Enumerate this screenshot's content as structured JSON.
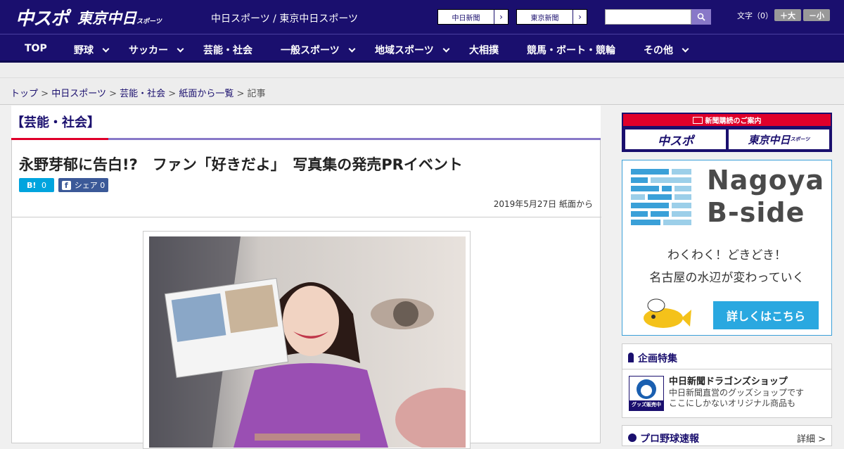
{
  "header": {
    "logo_chunichi": "中スポ",
    "logo_tokyo": "東京中日",
    "logo_tokyo_sub": "スポーツ",
    "site_links": "中日スポーツ / 東京中日スポーツ",
    "paper_btn_1": "中日新聞",
    "paper_btn_2": "東京新聞",
    "fontsize_label": "文字（0）",
    "font_plus": "＋大",
    "font_minus": "－小"
  },
  "nav": {
    "items": [
      "TOP",
      "野球",
      "サッカー",
      "芸能・社会",
      "一般スポーツ",
      "地域スポーツ",
      "大相撲",
      "競馬・ボート・競輪",
      "その他"
    ]
  },
  "breadcrumb": {
    "top": "トップ",
    "chunichi": "中日スポーツ",
    "geino": "芸能・社会",
    "list": "紙面から一覧",
    "current": "記事",
    "sep": ">"
  },
  "article": {
    "category": "【芸能・社会】",
    "title": "永野芽郁に告白!?　ファン「好きだよ」　写真集の発売PRイベント",
    "hatena_label": "B!",
    "hatena_count": "0",
    "fb_label": "シェア",
    "fb_count": "0",
    "date": "2019年5月27日 紙面から"
  },
  "sidebar": {
    "subscribe_head": "新聞購読のご案内",
    "sub_logo_1": "中スポ",
    "sub_logo_2": "東京中日",
    "sub_logo_2_sub": "スポーツ",
    "bside_title_1": "Nagoya",
    "bside_title_2": "B-side",
    "bside_tag_1": "わくわく！どきどき！",
    "bside_tag_2": "名古屋の水辺が変わっていく",
    "bside_btn": "詳しくはこちら",
    "feature_head": "企画特集",
    "feature_name": "中日新聞ドラゴンズショップ",
    "feature_desc_1": "中日新聞直営のグッズショップです",
    "feature_desc_2": "ここにしかないオリジナル商品も",
    "feature_img_label": "グッズ販売中",
    "live_title": "プロ野球速報",
    "live_more": "詳細 >"
  },
  "colors": {
    "brand": "#1a0f6e",
    "accent_red": "#e0002a",
    "accent_purple": "#8878c8",
    "bside_blue": "#2aa8e0"
  }
}
